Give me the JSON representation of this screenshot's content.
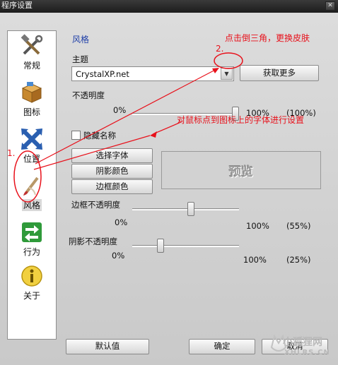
{
  "window": {
    "title": "程序设置",
    "close_glyph": "✕"
  },
  "sidebar": {
    "items": [
      {
        "label": "常规",
        "icon": "tools-icon"
      },
      {
        "label": "图标",
        "icon": "box-icon"
      },
      {
        "label": "位置",
        "icon": "move-arrows-icon"
      },
      {
        "label": "风格",
        "icon": "brush-icon",
        "selected": true
      },
      {
        "label": "行为",
        "icon": "switch-arrows-icon"
      },
      {
        "label": "关于",
        "icon": "info-icon"
      }
    ]
  },
  "main": {
    "section_title": "风格",
    "theme": {
      "label": "主题",
      "value": "CrystalXP.net",
      "get_more": "获取更多"
    },
    "opacity": {
      "label": "不透明度",
      "min": "0%",
      "max": "100%",
      "current": "(100%)",
      "value": 100
    },
    "hide_names": {
      "label": "隐藏名称",
      "checked": false
    },
    "buttons": {
      "font": "选择字体",
      "shadow_color": "阴影颜色",
      "border_color": "边框颜色"
    },
    "preview": "预览",
    "border_opacity": {
      "label": "边框不透明度",
      "min": "0%",
      "max": "100%",
      "current": "(55%)",
      "value": 55
    },
    "shadow_opacity": {
      "label": "阴影不透明度",
      "min": "0%",
      "max": "100%",
      "current": "(25%)",
      "value": 25
    }
  },
  "footer": {
    "defaults": "默认值",
    "ok": "确定",
    "cancel": "取消"
  },
  "annotations": {
    "step1": "1.",
    "step2": "2.",
    "note_theme": "点击倒三角，更换皮肤",
    "note_font": "对鼠标点到图标上的字体进行设置"
  },
  "watermark": {
    "line1": "小狐狸网",
    "line2": "XHLRS.CN"
  },
  "colors": {
    "accent_title": "#1f3fa8",
    "annotation": "#e8101a"
  }
}
